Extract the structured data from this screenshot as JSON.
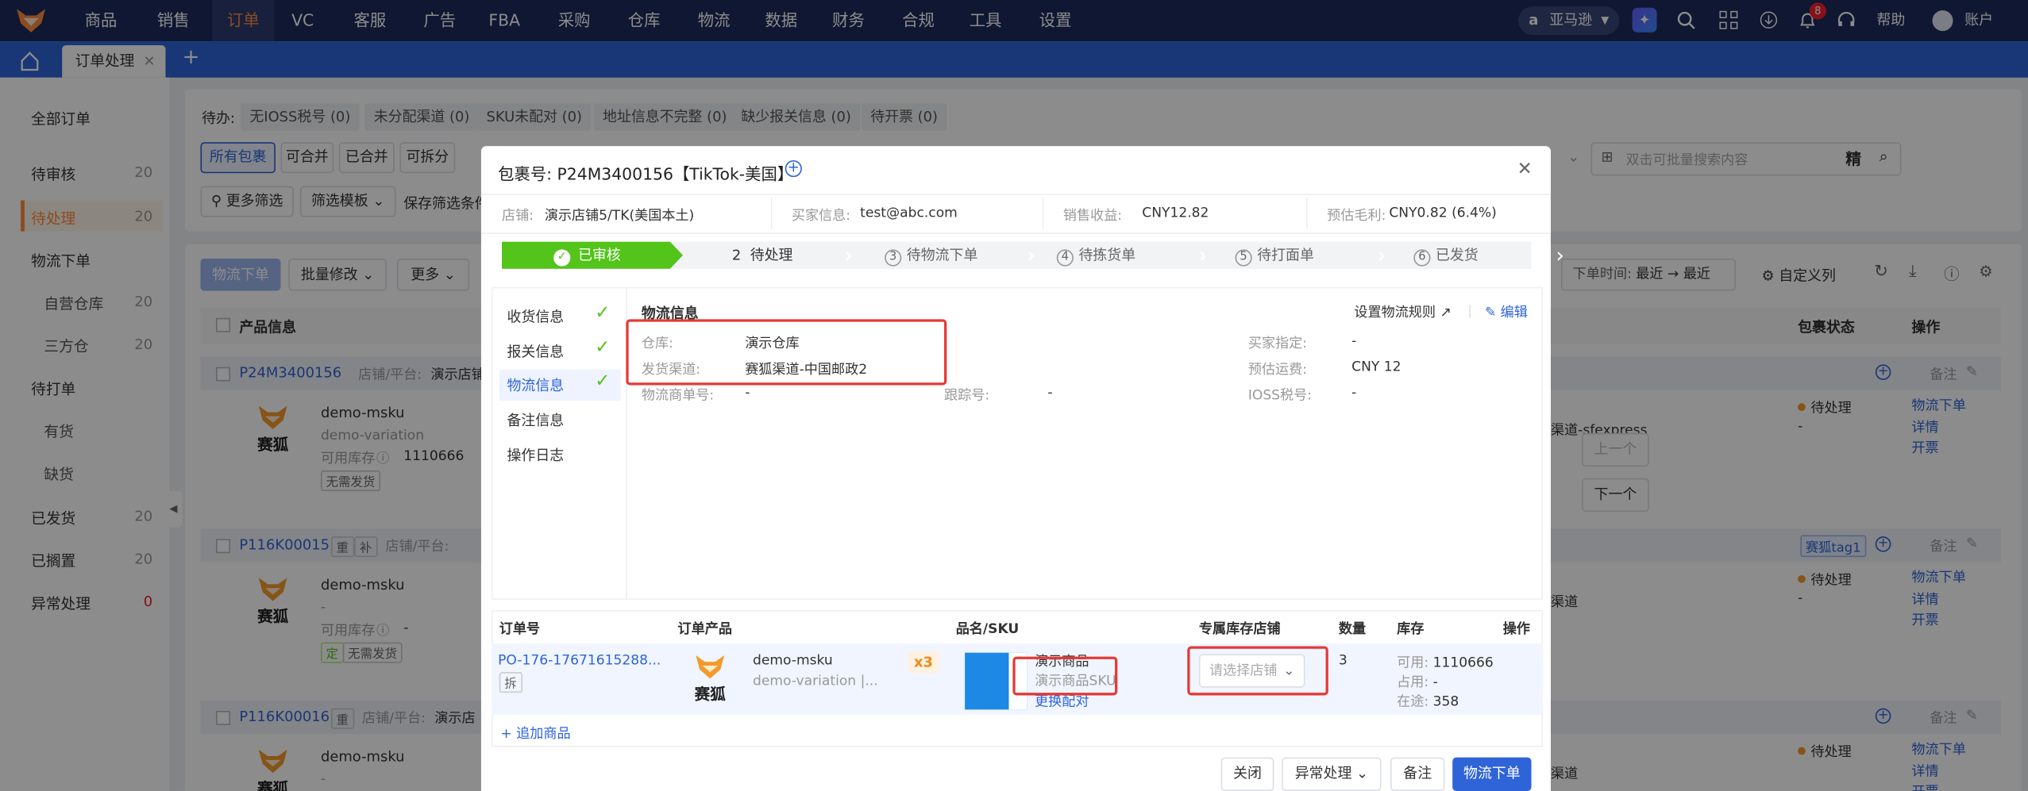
{
  "nav": {
    "items": [
      "商品",
      "销售",
      "订单",
      "VC",
      "客服",
      "广告",
      "FBA",
      "采购",
      "仓库",
      "物流",
      "数据",
      "财务",
      "合规",
      "工具",
      "设置"
    ],
    "marketplace": "亚马逊",
    "notif_count": "8",
    "help": "帮助",
    "account": "账户"
  },
  "tabbar": {
    "active_tab": "订单处理"
  },
  "sidebar": {
    "all": "全部订单",
    "items": [
      {
        "label": "待审核",
        "count": "20"
      },
      {
        "label": "待处理",
        "count": "20"
      },
      {
        "label": "物流下单",
        "count": ""
      },
      {
        "label": "自营仓库",
        "count": "20"
      },
      {
        "label": "三方仓",
        "count": "20"
      },
      {
        "label": "待打单",
        "count": ""
      },
      {
        "label": "有货",
        "count": ""
      },
      {
        "label": "缺货",
        "count": ""
      },
      {
        "label": "已发货",
        "count": "20"
      },
      {
        "label": "已搁置",
        "count": "20"
      },
      {
        "label": "异常处理",
        "count": "0"
      }
    ]
  },
  "filters": {
    "pending_label": "待办:",
    "pending": [
      "无IOSS税号 (0)",
      "未分配渠道 (0)",
      "SKU未配对 (0)",
      "地址信息不完整 (0)",
      "缺少报关信息 (0)",
      "待开票 (0)"
    ],
    "types": [
      "所有包裹",
      "可合并",
      "已合并",
      "可拆分"
    ],
    "more_filter": "更多筛选",
    "filter_tpl": "筛选模板",
    "save_filter": "保存筛选条件",
    "search_placeholder": "双击可批量搜索内容",
    "precise": "精"
  },
  "toolbar": {
    "logistics": "物流下单",
    "bulk": "批量修改",
    "more": "更多",
    "order_time": "下单时间:",
    "time_range": "最近 → 最近",
    "custom_cols": "自定义列"
  },
  "table": {
    "headers": {
      "product": "产品信息",
      "status": "包裹状态",
      "ops": "操作"
    },
    "rows": [
      {
        "id": "P24M3400156",
        "shop": "店铺/平台:",
        "shop_val": "演示店铺",
        "msku": "demo-msku",
        "variation": "demo-variation",
        "stock_label": "可用库存",
        "stock": "1110666",
        "tag": "无需发货",
        "status": "待处理",
        "dash": "-",
        "channel": "渠道-sfexpress",
        "remark": "备注",
        "ops": [
          "物流下单",
          "详情",
          "开票"
        ]
      },
      {
        "id": "P116K00015",
        "badges": [
          "重",
          "补"
        ],
        "shop": "店铺/平台:",
        "msku": "demo-msku",
        "variation": "-",
        "stock_label": "可用库存",
        "stock": "-",
        "tags": [
          "定",
          "无需发货"
        ],
        "status": "待处理",
        "dash": "-",
        "channel": "渠道",
        "label_tag": "赛狐tag1",
        "remark": "备注",
        "ops": [
          "物流下单",
          "详情",
          "开票"
        ]
      },
      {
        "id": "P116K00016",
        "badges": [
          "重"
        ],
        "shop": "店铺/平台:",
        "shop_val": "演示店",
        "msku": "demo-msku",
        "variation": "-",
        "status": "待处理",
        "channel": "渠道",
        "remark": "备注",
        "ops": [
          "物流下单",
          "详情",
          "开票"
        ]
      }
    ]
  },
  "brand_text": "赛狐",
  "side_buttons": {
    "prev": "上一个",
    "next": "下一个"
  },
  "modal": {
    "title": "包裹号: P24M3400156【TikTok-美国】",
    "info": [
      {
        "label": "店铺:",
        "value": "演示店铺5/TK(美国本土)"
      },
      {
        "label": "买家信息:",
        "value": "test@abc.com"
      },
      {
        "label": "销售收益:",
        "value": "CNY12.82"
      },
      {
        "label": "预估毛利:",
        "value": "CNY0.82 (6.4%)"
      }
    ],
    "steps": [
      {
        "n": "1",
        "label": "已审核"
      },
      {
        "n": "2",
        "label": "待处理"
      },
      {
        "n": "3",
        "label": "待物流下单"
      },
      {
        "n": "4",
        "label": "待拣货单"
      },
      {
        "n": "5",
        "label": "待打面单"
      },
      {
        "n": "6",
        "label": "已发货"
      }
    ],
    "menu": [
      "收货信息",
      "报关信息",
      "物流信息",
      "备注信息",
      "操作日志"
    ],
    "logistics": {
      "title": "物流信息",
      "set_rule": "设置物流规则",
      "edit": "编辑",
      "warehouse_label": "仓库:",
      "warehouse": "演示仓库",
      "channel_label": "发货渠道:",
      "channel": "赛狐渠道-中国邮政2",
      "buyer_spec_label": "买家指定:",
      "buyer_spec": "-",
      "est_freight_label": "预估运费:",
      "est_freight": "CNY 12",
      "tracking_co_label": "物流商单号:",
      "tracking_co": "-",
      "tracking_label": "跟踪号:",
      "tracking": "-",
      "ioss_label": "IOSS税号:",
      "ioss": "-"
    },
    "items_table": {
      "headers": [
        "订单号",
        "订单产品",
        "品名/SKU",
        "专属库存店铺",
        "数量",
        "库存",
        "操作"
      ],
      "row": {
        "order_no": "PO-176-17671615288...",
        "split": "拆",
        "msku": "demo-msku",
        "variation": "demo-variation |...",
        "qty_badge": "x3",
        "name": "演示商品",
        "sku": "演示商品SKU",
        "change": "更换配对",
        "shop_placeholder": "请选择店铺",
        "qty": "3",
        "avail_label": "可用:",
        "avail": "1110666",
        "occupied_label": "占用:",
        "occupied": "-",
        "transit_label": "在途:",
        "transit": "358"
      },
      "add": "追加商品"
    },
    "footer": {
      "close": "关闭",
      "exception": "异常处理",
      "remark": "备注",
      "submit": "物流下单"
    }
  },
  "colors": {
    "nav_bg": "#1d2a5b",
    "tab_bg": "#2f64d8",
    "accent": "#ff8a3d",
    "success": "#52c41a",
    "primary": "#2f64d8",
    "highlight": "#e53935"
  }
}
